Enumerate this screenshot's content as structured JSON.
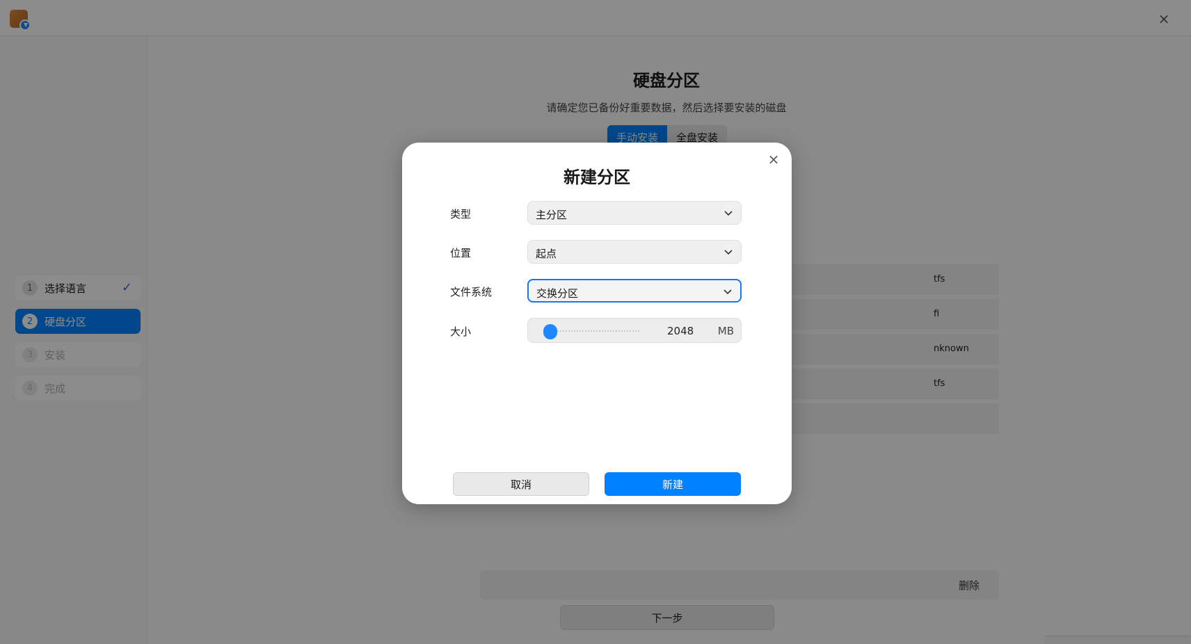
{
  "window": {
    "close_glyph": "×",
    "app_icon": "installer-icon"
  },
  "sidebar": {
    "steps": [
      {
        "num": "1",
        "label": "选择语言",
        "state": "done"
      },
      {
        "num": "2",
        "label": "硬盘分区",
        "state": "active"
      },
      {
        "num": "3",
        "label": "安装",
        "state": "disabled"
      },
      {
        "num": "4",
        "label": "完成",
        "state": "disabled"
      }
    ],
    "check_glyph": "✓"
  },
  "main": {
    "title": "硬盘分区",
    "subtitle": "请确定您已备份好重要数据，然后选择要安装的磁盘",
    "tabs": [
      {
        "label": "手动安装",
        "selected": true
      },
      {
        "label": "全盘安装",
        "selected": false
      }
    ],
    "partition_rows": [
      {
        "fs": "tfs"
      },
      {
        "fs": "fi"
      },
      {
        "fs": "nknown"
      },
      {
        "fs": "tfs"
      },
      {
        "fs": ""
      }
    ],
    "delete_label": "删除",
    "next_label": "下一步"
  },
  "dialog": {
    "title": "新建分区",
    "close_glyph": "×",
    "type": {
      "label": "类型",
      "value": "主分区"
    },
    "location": {
      "label": "位置",
      "value": "起点"
    },
    "filesystem": {
      "label": "文件系统",
      "value": "交换分区"
    },
    "size": {
      "label": "大小",
      "value": "2048",
      "unit": "MB",
      "slider_fraction": 0.02
    },
    "cancel_label": "取消",
    "create_label": "新建"
  },
  "colors": {
    "accent": "#0081ff",
    "overlay": "rgba(0,0,0,0.45)"
  }
}
